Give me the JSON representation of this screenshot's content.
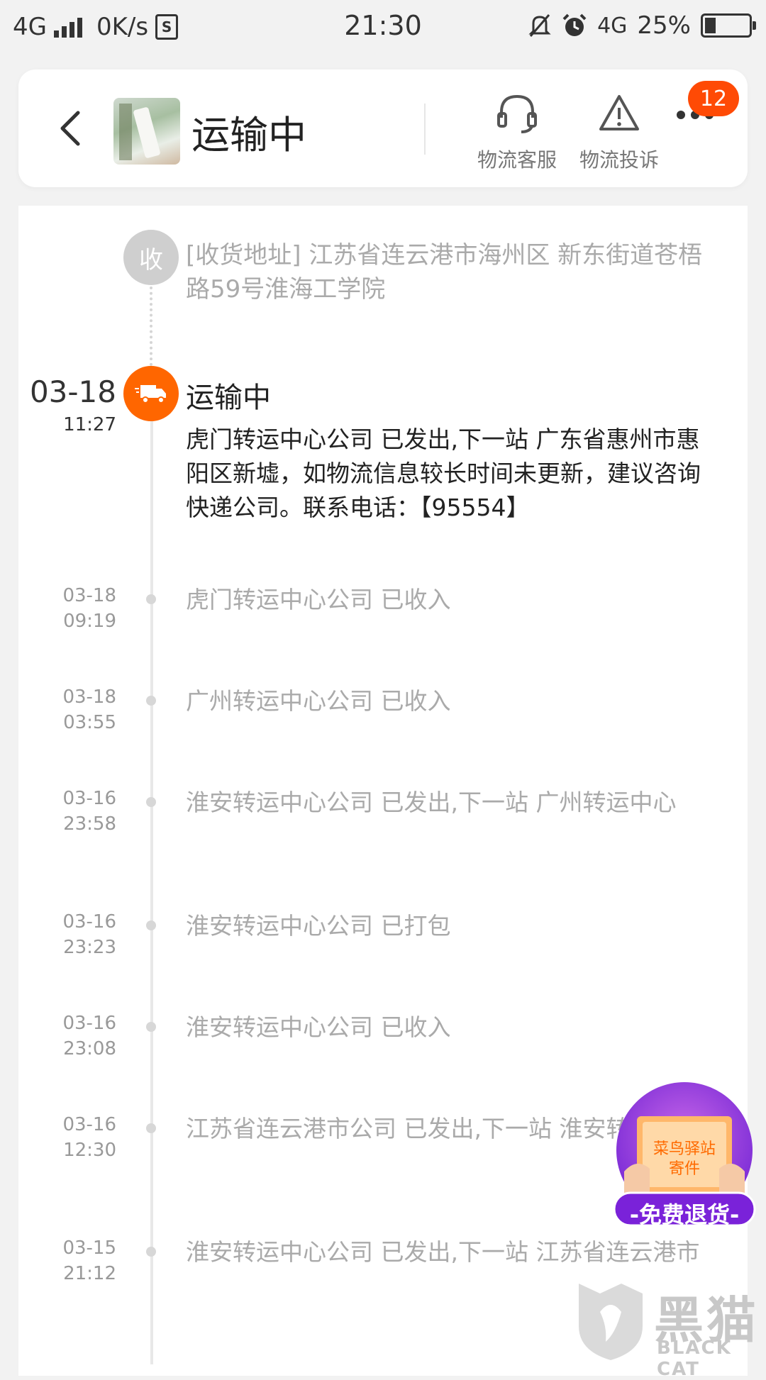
{
  "status_bar": {
    "network": "4G",
    "speed": "0K/s",
    "sim_glyph": "S",
    "time": "21:30",
    "network_right": "4G",
    "battery": "25%"
  },
  "header": {
    "title": "运输中",
    "service_label": "物流客服",
    "complaint_label": "物流投诉",
    "badge": "12"
  },
  "timeline": {
    "address_icon": "收",
    "address_text": "[收货地址] 江苏省连云港市海州区 新东街道苍梧路59号淮海工学院",
    "current": {
      "date": "03-18",
      "time": "11:27",
      "title": "运输中",
      "text": "虎门转运中心公司 已发出,下一站 广东省惠州市惠阳区新墟，如物流信息较长时间未更新，建议咨询快递公司。联系电话：【95554】"
    },
    "events": [
      {
        "date": "03-18",
        "time": "09:19",
        "text": "虎门转运中心公司 已收入"
      },
      {
        "date": "03-18",
        "time": "03:55",
        "text": "广州转运中心公司 已收入"
      },
      {
        "date": "03-16",
        "time": "23:58",
        "text": "淮安转运中心公司 已发出,下一站 广州转运中心"
      },
      {
        "date": "03-16",
        "time": "23:23",
        "text": "淮安转运中心公司 已打包"
      },
      {
        "date": "03-16",
        "time": "23:08",
        "text": "淮安转运中心公司 已收入"
      },
      {
        "date": "03-16",
        "time": "12:30",
        "text": "江苏省连云港市公司 已发出,下一站 淮安转运中心"
      },
      {
        "date": "03-15",
        "time": "21:12",
        "text": "淮安转运中心公司 已发出,下一站 江苏省连云港市"
      }
    ]
  },
  "promo": {
    "line1": "菜鸟驿站",
    "line2": "寄件",
    "button": "-免费退货-"
  },
  "watermark": {
    "cn": "黑猫",
    "en": "BLACK CAT"
  },
  "colors": {
    "accent": "#ff6600",
    "badge": "#ff4a05",
    "promo_purple": "#7a2bd6"
  }
}
